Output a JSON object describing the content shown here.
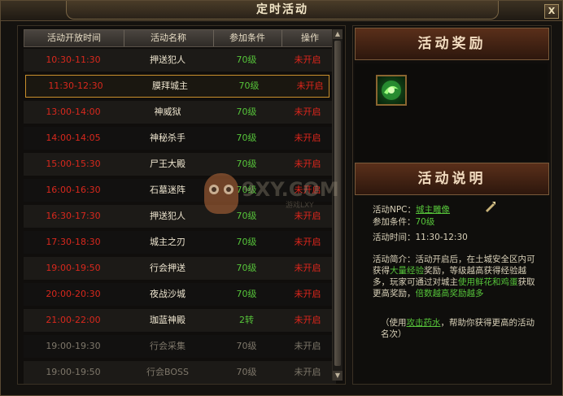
{
  "window": {
    "title": "定时活动",
    "close_label": "X"
  },
  "table": {
    "headers": [
      "活动开放时间",
      "活动名称",
      "参加条件",
      "操作"
    ],
    "rows": [
      {
        "time": "10:30-11:30",
        "name": "押送犯人",
        "cond": "70级",
        "op": "未开启",
        "state": "red"
      },
      {
        "time": "11:30-12:30",
        "name": "膜拜城主",
        "cond": "70级",
        "op": "未开启",
        "state": "red"
      },
      {
        "time": "13:00-14:00",
        "name": "神威狱",
        "cond": "70级",
        "op": "未开启",
        "state": "red"
      },
      {
        "time": "14:00-14:05",
        "name": "神秘杀手",
        "cond": "70级",
        "op": "未开启",
        "state": "red"
      },
      {
        "time": "15:00-15:30",
        "name": "尸王大殿",
        "cond": "70级",
        "op": "未开启",
        "state": "red"
      },
      {
        "time": "16:00-16:30",
        "name": "石墓迷阵",
        "cond": "70级",
        "op": "未开启",
        "state": "red"
      },
      {
        "time": "16:30-17:30",
        "name": "押送犯人",
        "cond": "70级",
        "op": "未开启",
        "state": "red"
      },
      {
        "time": "17:30-18:30",
        "name": "城主之刃",
        "cond": "70级",
        "op": "未开启",
        "state": "red"
      },
      {
        "time": "19:00-19:50",
        "name": "行会押送",
        "cond": "70级",
        "op": "未开启",
        "state": "red"
      },
      {
        "time": "20:00-20:30",
        "name": "夜战沙城",
        "cond": "70级",
        "op": "未开启",
        "state": "red"
      },
      {
        "time": "21:00-22:00",
        "name": "珈蓝神殿",
        "cond": "2转",
        "op": "未开启",
        "state": "red"
      },
      {
        "time": "19:00-19:30",
        "name": "行会采集",
        "cond": "70级",
        "op": "未开启",
        "state": "gray"
      },
      {
        "time": "19:00-19:50",
        "name": "行会BOSS",
        "cond": "70级",
        "op": "未开启",
        "state": "gray"
      }
    ],
    "selected_index": 1
  },
  "reward": {
    "heading": "活动奖励",
    "item_icon": "exp-orb-icon"
  },
  "description": {
    "heading": "活动说明",
    "npc_label": "活动NPC：",
    "npc_value": "城主雕像",
    "cond_label": "参加条件：",
    "cond_value": "70级",
    "time_label": "活动时间：",
    "time_value": "11:30-12:30",
    "intro_1": "活动简介：活动开启后，在土城安全区内可获得",
    "intro_2": "大量经验",
    "intro_3": "奖励，等级越高获得经验越多，玩家可通过对城主",
    "intro_4": "使用鲜花和鸡蛋",
    "intro_5": "获取更高奖励，",
    "intro_6": "倍数越高奖励越多",
    "tip_1": "（使用",
    "tip_link": "攻击药水",
    "tip_2": "，帮助你获得更高的活动名次）"
  },
  "watermark": {
    "brand": "9XY.COM",
    "sub": "游戏LXY"
  },
  "colors": {
    "red": "#d8281d",
    "green": "#56c43a",
    "gray": "#7e776a",
    "accent": "#c98f2c"
  }
}
